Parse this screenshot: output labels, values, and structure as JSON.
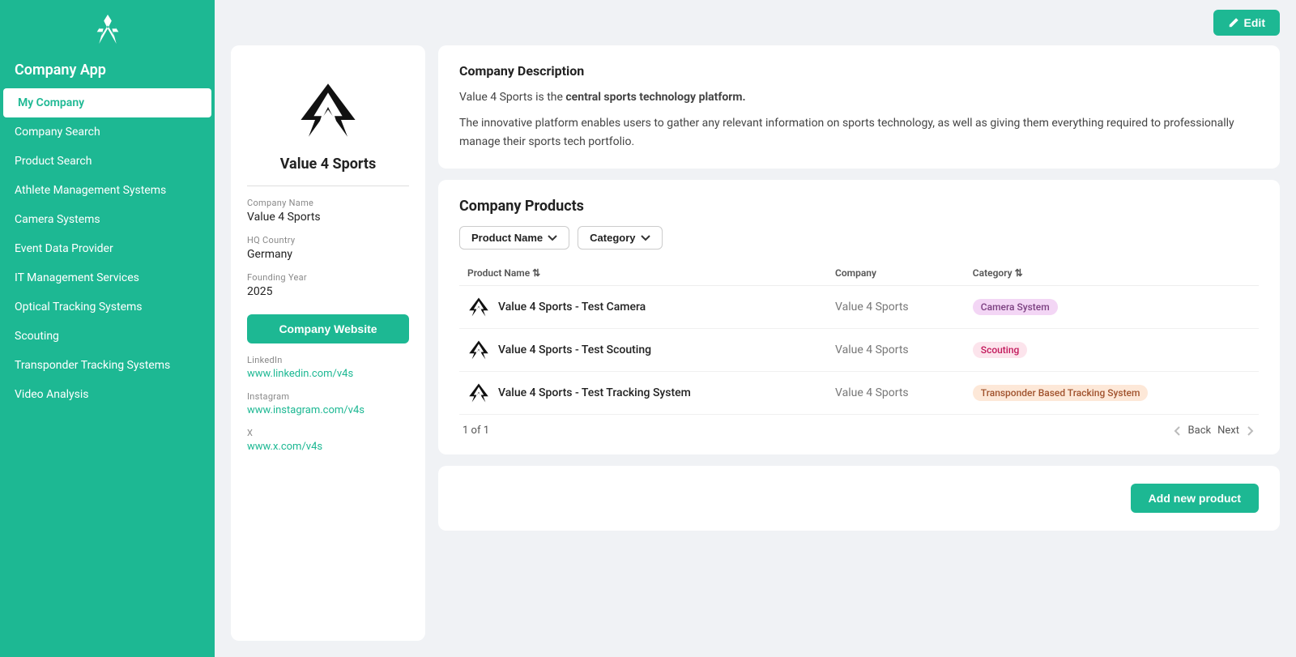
{
  "sidebar": {
    "app_title": "Company App",
    "items": [
      {
        "id": "my-company",
        "label": "My Company",
        "active": true
      },
      {
        "id": "company-search",
        "label": "Company Search",
        "active": false
      },
      {
        "id": "product-search",
        "label": "Product Search",
        "active": false
      },
      {
        "id": "athlete-management",
        "label": "Athlete Management Systems",
        "active": false
      },
      {
        "id": "camera-systems",
        "label": "Camera Systems",
        "active": false
      },
      {
        "id": "event-data",
        "label": "Event Data Provider",
        "active": false
      },
      {
        "id": "it-management",
        "label": "IT Management Services",
        "active": false
      },
      {
        "id": "optical-tracking",
        "label": "Optical Tracking Systems",
        "active": false
      },
      {
        "id": "scouting",
        "label": "Scouting",
        "active": false
      },
      {
        "id": "transponder",
        "label": "Transponder Tracking Systems",
        "active": false
      },
      {
        "id": "video-analysis",
        "label": "Video Analysis",
        "active": false
      }
    ]
  },
  "header": {
    "edit_label": "Edit"
  },
  "company_card": {
    "company_name_label": "Company Name",
    "company_name_value": "Value 4 Sports",
    "company_title": "Value 4 Sports",
    "hq_country_label": "HQ Country",
    "hq_country_value": "Germany",
    "founding_year_label": "Founding Year",
    "founding_year_value": "2025",
    "website_btn_label": "Company Website",
    "linkedin_label": "LinkedIn",
    "linkedin_value": "www.linkedin.com/v4s",
    "instagram_label": "Instagram",
    "instagram_value": "www.instagram.com/v4s",
    "x_label": "X",
    "x_value": "www.x.com/v4s"
  },
  "description": {
    "title": "Company Description",
    "line1_prefix": "Value 4 Sports is the ",
    "line1_bold": "central sports technology platform.",
    "line2": "The innovative platform enables users to gather any relevant information on sports technology, as well as giving them everything required to professionally manage their sports tech portfolio."
  },
  "products": {
    "title": "Company Products",
    "filter_product_name": "Product Name",
    "filter_category": "Category",
    "columns": {
      "product_name": "Product Name",
      "company": "Company",
      "category": "Category"
    },
    "rows": [
      {
        "name": "Value 4 Sports - Test Camera",
        "company": "Value 4 Sports",
        "category": "Camera System",
        "badge_class": "badge-camera"
      },
      {
        "name": "Value 4 Sports - Test Scouting",
        "company": "Value 4 Sports",
        "category": "Scouting",
        "badge_class": "badge-scouting"
      },
      {
        "name": "Value 4 Sports - Test Tracking System",
        "company": "Value 4 Sports",
        "category": "Transponder Based Tracking System",
        "badge_class": "badge-transponder"
      }
    ],
    "pagination": "1 of 1",
    "back_label": "Back",
    "next_label": "Next"
  },
  "add_product": {
    "btn_label": "Add new product"
  }
}
